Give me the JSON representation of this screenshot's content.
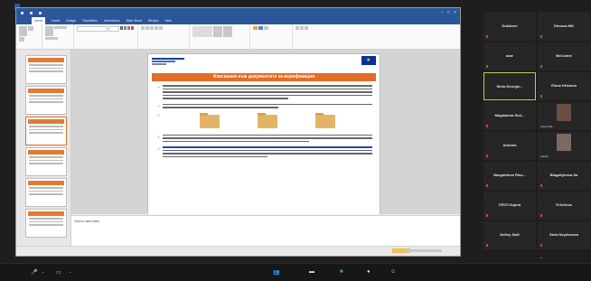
{
  "ppt": {
    "ribbon_tabs": [
      "Home",
      "Insert",
      "Design",
      "Transitions",
      "Animations",
      "Slide Show",
      "Review",
      "View"
    ],
    "notes_placeholder": "Click to add notes"
  },
  "slide": {
    "title": "Изискания към документите за верификация"
  },
  "participants": [
    {
      "name": "Dobikovi"
    },
    {
      "name": "Dimova MD"
    },
    {
      "name": "azar"
    },
    {
      "name": "BeComel"
    },
    {
      "name": "Stela Georgie..."
    },
    {
      "name": "Elena Hristova"
    },
    {
      "name": "Magdalena Stoi..."
    },
    {
      "name": "Liliya Dob..."
    },
    {
      "name": "Antonia"
    },
    {
      "name": "Ivanko..."
    },
    {
      "name": "Margaritova Riss..."
    },
    {
      "name": "Blagaliyhova Sa"
    },
    {
      "name": "ITEST-Ilupna"
    },
    {
      "name": "R.Ilcheva"
    },
    {
      "name": "Nelluy Saill"
    },
    {
      "name": "Stela Neydenova"
    }
  ],
  "colors": {
    "ppt_blue": "#2b579a",
    "slide_accent": "#e36c26",
    "active_speaker": "#b6d04a",
    "video_green": "#29c45b",
    "muted_red": "#d43f3f"
  },
  "icons": {
    "mic": "microphone-icon",
    "video": "video-camera-icon",
    "share": "share-screen-icon",
    "participants": "participants-icon",
    "chat": "chat-icon",
    "record": "record-icon",
    "reactions": "reactions-icon",
    "more": "more-icon"
  }
}
